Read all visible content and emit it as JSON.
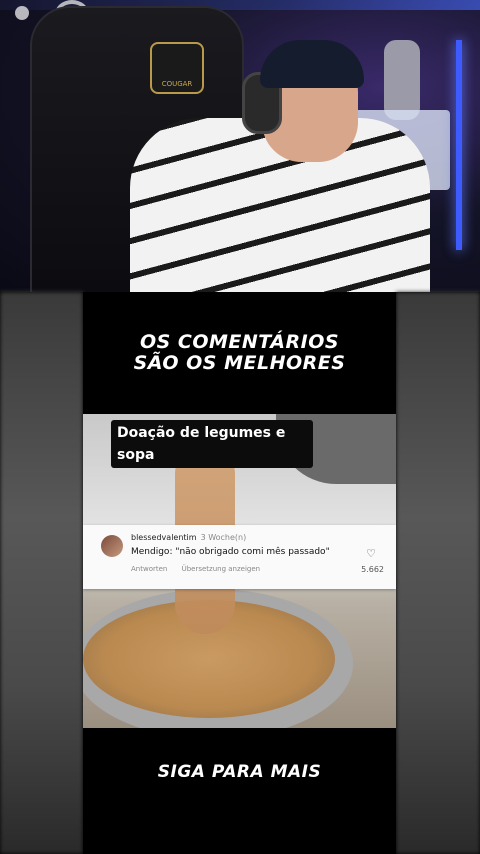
{
  "headline": {
    "line1": "OS COMENTÁRIOS",
    "line2": "SÃO OS MELHORES",
    "emojis": "😂😂😂"
  },
  "video": {
    "caption": "Doação de legumes e sopa",
    "comment": {
      "user": "blessedvalentim",
      "time": "3 Woche(n)",
      "text": "Mendigo: \"não obrigado comi mês passado\"",
      "reply": "Antworten",
      "translate": "Übersetzung anzeigen",
      "likes": "5.662"
    }
  },
  "cta": "SIGA PARA MAIS",
  "webcam": {
    "chair_brand": "COUGAR"
  }
}
